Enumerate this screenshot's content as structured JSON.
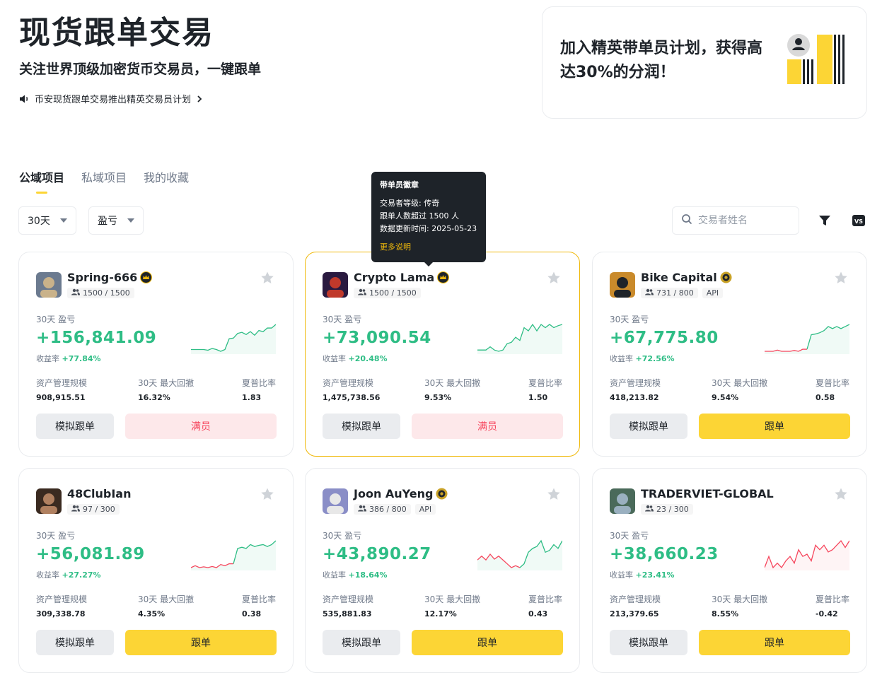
{
  "hero": {
    "title": "现货跟单交易",
    "subtitle": "关注世界顶级加密货币交易员，一键跟单",
    "announcement": "币安现货跟单交易推出精英交易员计划"
  },
  "promo": {
    "text": "加入精英带单员计划，获得高达30%的分润！"
  },
  "tabs": [
    {
      "label": "公域项目",
      "active": true
    },
    {
      "label": "私域项目",
      "active": false
    },
    {
      "label": "我的收藏",
      "active": false
    }
  ],
  "filters": {
    "period": "30天",
    "sort": "盈亏"
  },
  "search": {
    "placeholder": "交易者姓名"
  },
  "tooltip": {
    "title": "带单员徽章",
    "line1": "交易者等级: 传奇",
    "line2": "跟单人数超过 1500 人",
    "line3": "数据更新时间: 2025-05-23",
    "link": "更多说明"
  },
  "labels": {
    "pnl": "30天 盈亏",
    "roi": "收益率",
    "aum": "资产管理规模",
    "mdd": "30天 最大回撤",
    "sharpe": "夏普比率",
    "simulate": "模拟跟单"
  },
  "colors": {
    "brand_yellow": "#fcd535",
    "up_green": "#2ebd85",
    "down_red": "#f6465d"
  },
  "cards": [
    {
      "name": "Spring-666",
      "followers": "1500 / 1500",
      "api": "",
      "badge": "crown-badge-icon",
      "pnl": "+156,841.09",
      "roi": "+77.84%",
      "aum": "908,915.51",
      "mdd": "16.32%",
      "sharpe": "1.83",
      "action": "满员",
      "action_type": "full",
      "highlight": false,
      "spark": [
        2,
        2,
        2,
        2,
        1.8,
        2.3,
        2,
        1.5,
        2,
        5,
        5.2,
        6.5,
        6.8,
        6.2,
        7,
        6,
        7.3,
        7,
        8,
        8,
        9
      ],
      "spark_color": "green"
    },
    {
      "name": "Crypto Lama",
      "followers": "1500 / 1500",
      "api": "",
      "badge": "crown-badge-icon",
      "pnl": "+73,090.54",
      "roi": "+20.48%",
      "aum": "1,475,738.56",
      "mdd": "9.53%",
      "sharpe": "1.50",
      "action": "满员",
      "action_type": "full",
      "highlight": true,
      "spark": [
        4,
        4,
        4,
        4.5,
        4,
        3.8,
        4,
        5,
        5.2,
        6,
        5.5,
        7.5,
        7,
        8,
        7,
        8,
        7.5,
        8,
        7.5,
        7.8,
        8
      ],
      "spark_color": "green"
    },
    {
      "name": "Bike Capital",
      "followers": "731 / 800",
      "api": "API",
      "badge": "medal-badge-icon",
      "pnl": "+67,775.80",
      "roi": "+72.56%",
      "aum": "418,213.82",
      "mdd": "9.54%",
      "sharpe": "0.58",
      "action": "跟单",
      "action_type": "copy",
      "highlight": false,
      "spark": [
        3,
        3,
        3,
        3.3,
        3,
        3,
        3,
        3.2,
        3,
        3.5,
        3.5,
        7,
        7.2,
        7.5,
        8,
        9,
        8.5,
        9,
        8.5,
        9,
        9.5
      ],
      "spark_color": "mixed"
    },
    {
      "name": "48ClubIan",
      "followers": "97 / 300",
      "api": "",
      "badge": "",
      "pnl": "+56,081.89",
      "roi": "+27.27%",
      "aum": "309,338.78",
      "mdd": "4.35%",
      "sharpe": "0.38",
      "action": "跟单",
      "action_type": "copy",
      "highlight": false,
      "spark": [
        2,
        2.5,
        2,
        2.2,
        2,
        2.3,
        2,
        2.8,
        2.5,
        3,
        3,
        7,
        7.3,
        7,
        8,
        7.5,
        7.8,
        8,
        7.5,
        8,
        9
      ],
      "spark_color": "mixed"
    },
    {
      "name": "Joon AuYeng",
      "followers": "386 / 800",
      "api": "API",
      "badge": "medal-badge-icon",
      "pnl": "+43,890.27",
      "roi": "+18.64%",
      "aum": "535,881.83",
      "mdd": "12.17%",
      "sharpe": "0.43",
      "action": "跟单",
      "action_type": "copy",
      "highlight": false,
      "spark": [
        4,
        5,
        4,
        5.5,
        4.2,
        5,
        4,
        3,
        2,
        2.5,
        2,
        3,
        6,
        7,
        7.5,
        9,
        6,
        6.5,
        8,
        7,
        9
      ],
      "spark_color": "mixed"
    },
    {
      "name": "TRADERVIET-GLOBAL",
      "followers": "23 / 300",
      "api": "",
      "badge": "",
      "pnl": "+38,660.23",
      "roi": "+23.41%",
      "aum": "213,379.65",
      "mdd": "8.55%",
      "sharpe": "-0.42",
      "action": "跟单",
      "action_type": "copy",
      "highlight": false,
      "spark": [
        3,
        3.5,
        3,
        3.2,
        3,
        3.3,
        3.5,
        3.2,
        3.8,
        3.5,
        3.6,
        3.3,
        4,
        3.8,
        4,
        3.7,
        3.8,
        4,
        4.2,
        3.9,
        4.2
      ],
      "spark_color": "red"
    }
  ]
}
